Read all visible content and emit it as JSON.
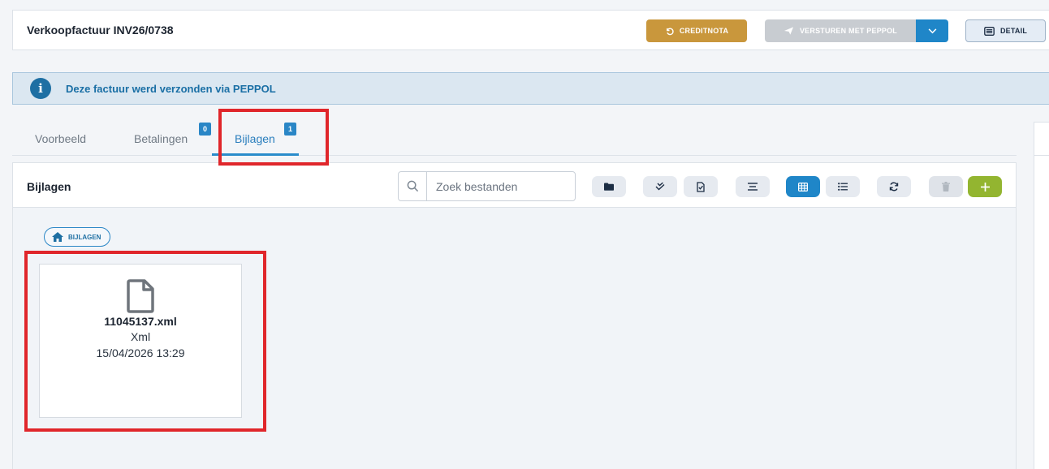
{
  "header": {
    "title": "Verkoopfactuur INV26/0738",
    "creditnota_label": "CREDITNOTA",
    "peppol_label": "VERSTUREN MET PEPPOL",
    "detail_label": "DETAIL"
  },
  "info": {
    "message": "Deze factuur werd verzonden via PEPPOL"
  },
  "tabs": [
    {
      "label": "Voorbeeld"
    },
    {
      "label": "Betalingen",
      "badge": "0"
    },
    {
      "label": "Bijlagen",
      "badge": "1",
      "active": true
    }
  ],
  "panel": {
    "title": "Bijlagen",
    "search_placeholder": "Zoek bestanden",
    "breadcrumb": "BIJLAGEN"
  },
  "files": [
    {
      "name": "11045137.xml",
      "type": "Xml",
      "date": "15/04/2026 13:29"
    }
  ],
  "colors": {
    "credit": "#c9973c",
    "accent": "#1f86c8",
    "add": "#93b530",
    "highlight": "#e0262b"
  }
}
